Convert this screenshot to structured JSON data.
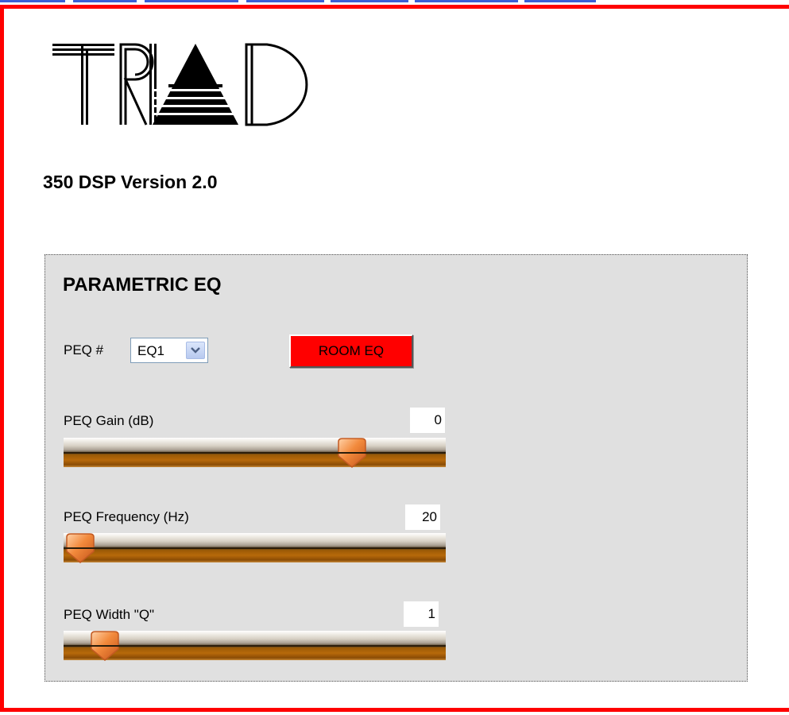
{
  "brand": {
    "logo_text": "TRIAD"
  },
  "page": {
    "title": "350 DSP Version 2.0"
  },
  "eq": {
    "heading": "PARAMETRIC EQ",
    "peq_label": "PEQ #",
    "peq_selected": "EQ1",
    "room_eq_label": "ROOM EQ",
    "sliders": [
      {
        "label": "PEQ Gain (dB)",
        "value": "0",
        "position_fraction": 0.78
      },
      {
        "label": "PEQ Frequency (Hz)",
        "value": "20",
        "position_fraction": 0.0
      },
      {
        "label": "PEQ Width \"Q\"",
        "value": "1",
        "position_fraction": 0.07
      }
    ]
  },
  "colors": {
    "frame": "#ff0000",
    "button": "#ff0000",
    "panel": "#e0e0e0",
    "track": "#b7690a",
    "thumb": "#f07a2a"
  }
}
